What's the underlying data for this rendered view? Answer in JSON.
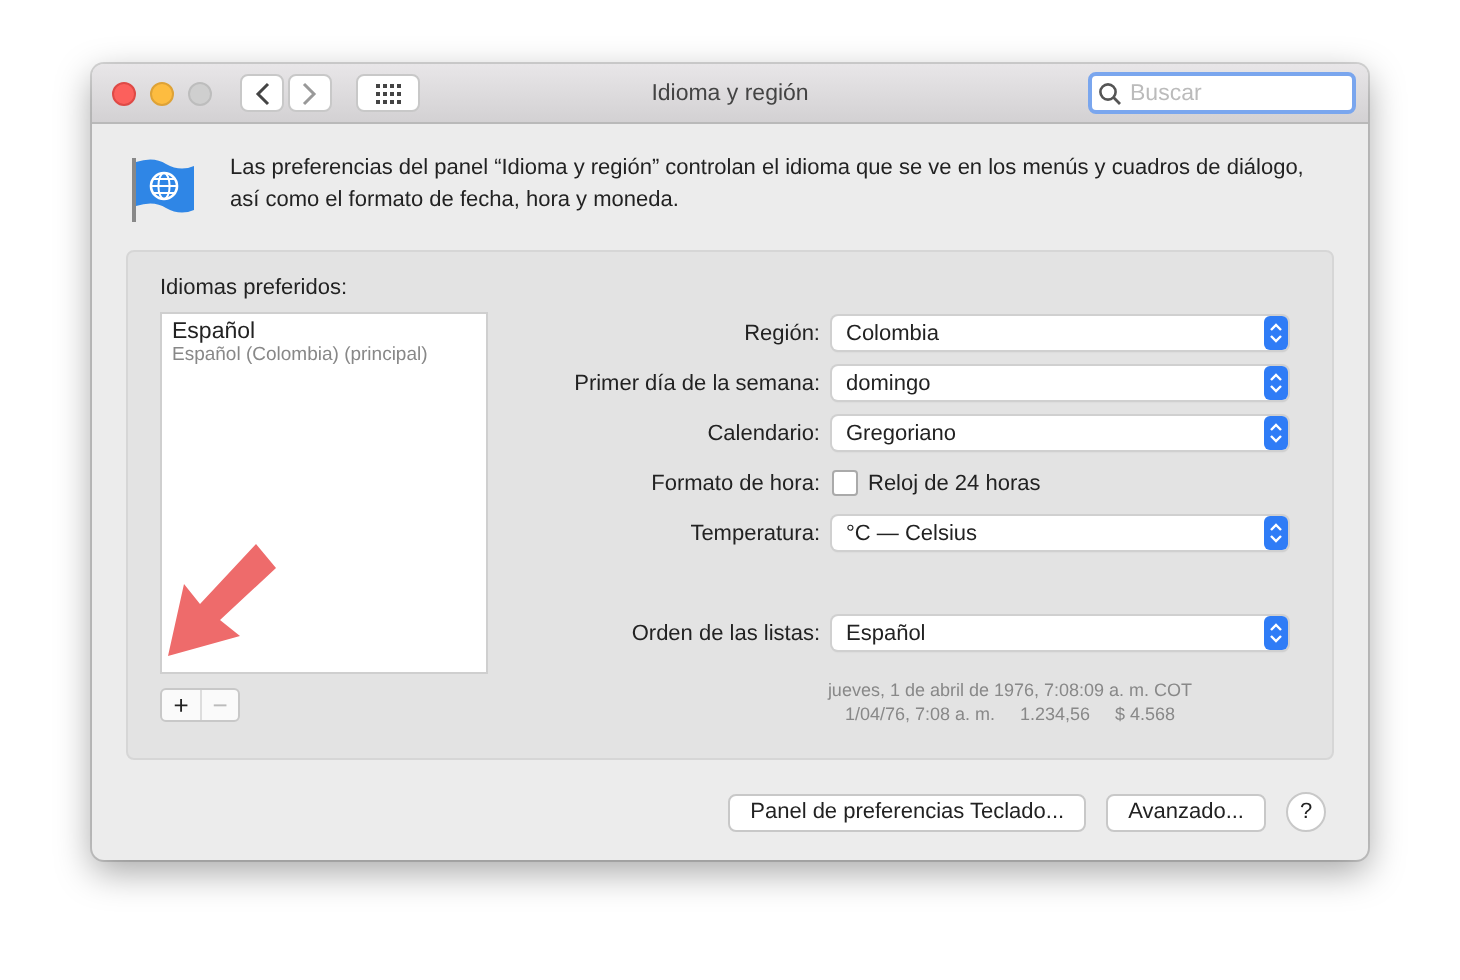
{
  "window": {
    "title": "Idioma y región"
  },
  "toolbar": {
    "search": {
      "placeholder": "Buscar"
    }
  },
  "description": "Las preferencias del panel “Idioma y región” controlan el idioma que se ve en los menús y cuadros de diálogo, así como el formato de fecha, hora y moneda.",
  "preferred_languages": {
    "label": "Idiomas preferidos:",
    "items": [
      {
        "name": "Español",
        "detail": "Español (Colombia) (principal)"
      }
    ],
    "buttons": [
      {
        "label": "+",
        "disabled": false
      },
      {
        "label": "−",
        "disabled": true
      }
    ]
  },
  "settings": [
    {
      "kind": "popup",
      "label": "Región:",
      "value": "Colombia"
    },
    {
      "kind": "popup",
      "label": "Primer día de la semana:",
      "value": "domingo"
    },
    {
      "kind": "popup",
      "label": "Calendario:",
      "value": "Gregoriano"
    },
    {
      "kind": "checkbox",
      "label": "Formato de hora:",
      "value": "Reloj de 24 horas",
      "checked": false
    },
    {
      "kind": "popup",
      "label": "Temperatura:",
      "value": "°C — Celsius"
    },
    {
      "kind": "spacer"
    },
    {
      "kind": "popup",
      "label": "Orden de las listas:",
      "value": "Español"
    }
  ],
  "sample": [
    "jueves, 1 de abril de 1976, 7:08:09 a. m. COT",
    "1/04/76, 7:08 a. m.     1.234,56     $ 4.568"
  ],
  "buttons": [
    "Panel de preferencias Teclado...",
    "Avanzado..."
  ],
  "help_button": "?"
}
